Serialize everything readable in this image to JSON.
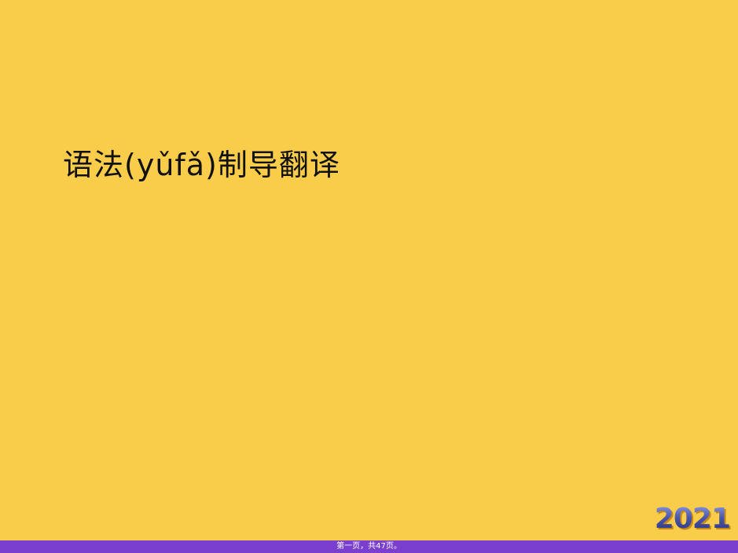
{
  "slide": {
    "title": "语法(yǔfǎ)制导翻译",
    "year_badge": "2021"
  },
  "footer": {
    "page_indicator": "第一页，共47页。"
  },
  "colors": {
    "background": "#f9cc4a",
    "footer_bar": "#7b3fd0",
    "badge": "#4a56a8"
  }
}
